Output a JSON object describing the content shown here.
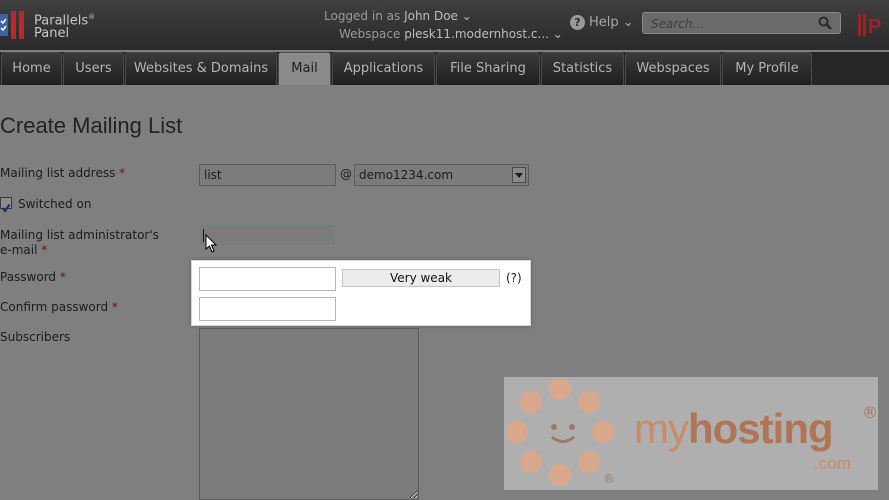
{
  "brand": {
    "line1": "Parallels",
    "line2": "Panel",
    "reg": "®",
    "corner": "P"
  },
  "header": {
    "logged_in_label": "Logged in as",
    "user_name": "John Doe",
    "webspace_label": "Webspace",
    "webspace_value": "plesk11.modernhost.c...",
    "help_label": "Help",
    "search_placeholder": "Search..."
  },
  "nav": {
    "tabs": [
      {
        "label": "Home"
      },
      {
        "label": "Users"
      },
      {
        "label": "Websites & Domains"
      },
      {
        "label": "Mail",
        "active": true
      },
      {
        "label": "Applications"
      },
      {
        "label": "File Sharing"
      },
      {
        "label": "Statistics"
      },
      {
        "label": "Webspaces"
      },
      {
        "label": "My Profile"
      }
    ]
  },
  "form": {
    "title": "Create Mailing List",
    "address_label": "Mailing list address",
    "address_value": "list",
    "at": "@",
    "domain_value": "demo1234.com",
    "switched_on_label": "Switched on",
    "switched_on_checked": true,
    "admin_email_label_1": "Mailing list administrator's",
    "admin_email_label_2": "e-mail",
    "admin_email_value": "",
    "password_label": "Password",
    "password_strength": "Very weak",
    "password_help": "(?)",
    "confirm_password_label": "Confirm password",
    "subscribers_label": "Subscribers",
    "required_mark": "*"
  },
  "watermark": {
    "text_light": "my",
    "text_bold": "hosting",
    "suffix": ".com",
    "reg": "®"
  },
  "colors": {
    "accent_watermark": "#c98b68",
    "topbar": "#2f2f2f",
    "overlay": "#7f7f7f"
  }
}
